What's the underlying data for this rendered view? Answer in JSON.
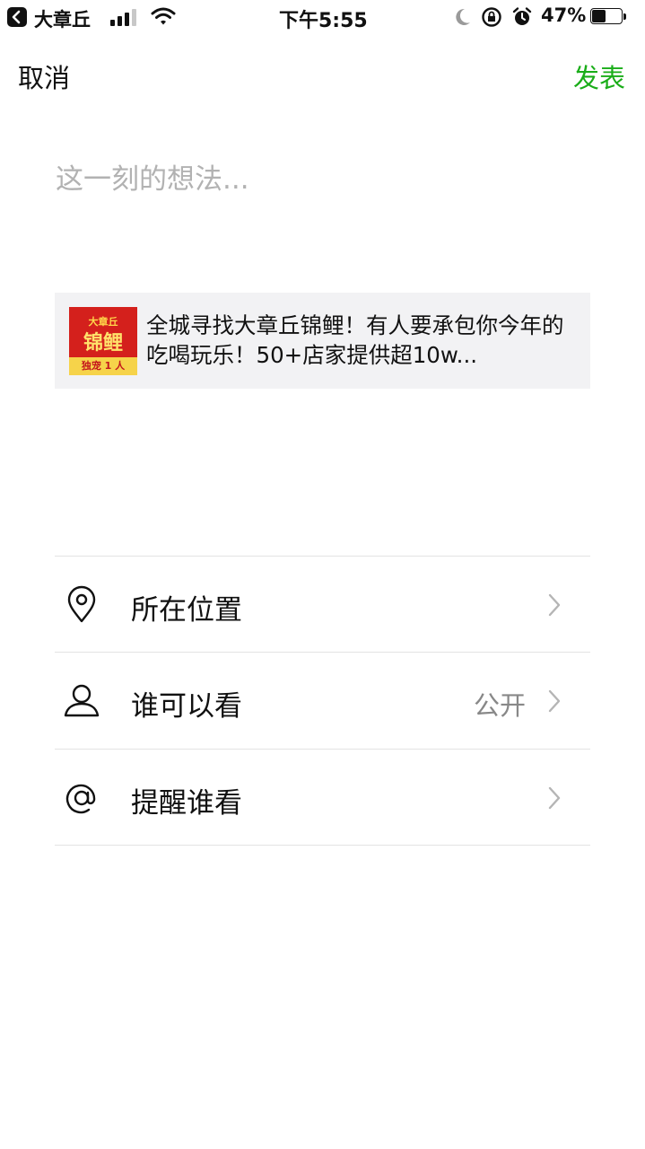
{
  "status_bar": {
    "carrier": "大章丘",
    "time": "下午5:55",
    "battery_percent": "47%",
    "battery_level": 0.47
  },
  "nav": {
    "cancel_label": "取消",
    "publish_label": "发表",
    "publish_color": "#1aad19"
  },
  "composer": {
    "placeholder": "这一刻的想法..."
  },
  "link_card": {
    "thumbnail": {
      "top_text": "大章丘",
      "main_text": "锦鲤",
      "bottom_text": "独宠 1 人"
    },
    "title": "全城寻找大章丘锦鲤！有人要承包你今年的吃喝玩乐！50+店家提供超10w..."
  },
  "options": [
    {
      "icon": "location-pin-icon",
      "label": "所在位置",
      "value": ""
    },
    {
      "icon": "person-icon",
      "label": "谁可以看",
      "value": "公开"
    },
    {
      "icon": "at-sign-icon",
      "label": "提醒谁看",
      "value": ""
    }
  ]
}
